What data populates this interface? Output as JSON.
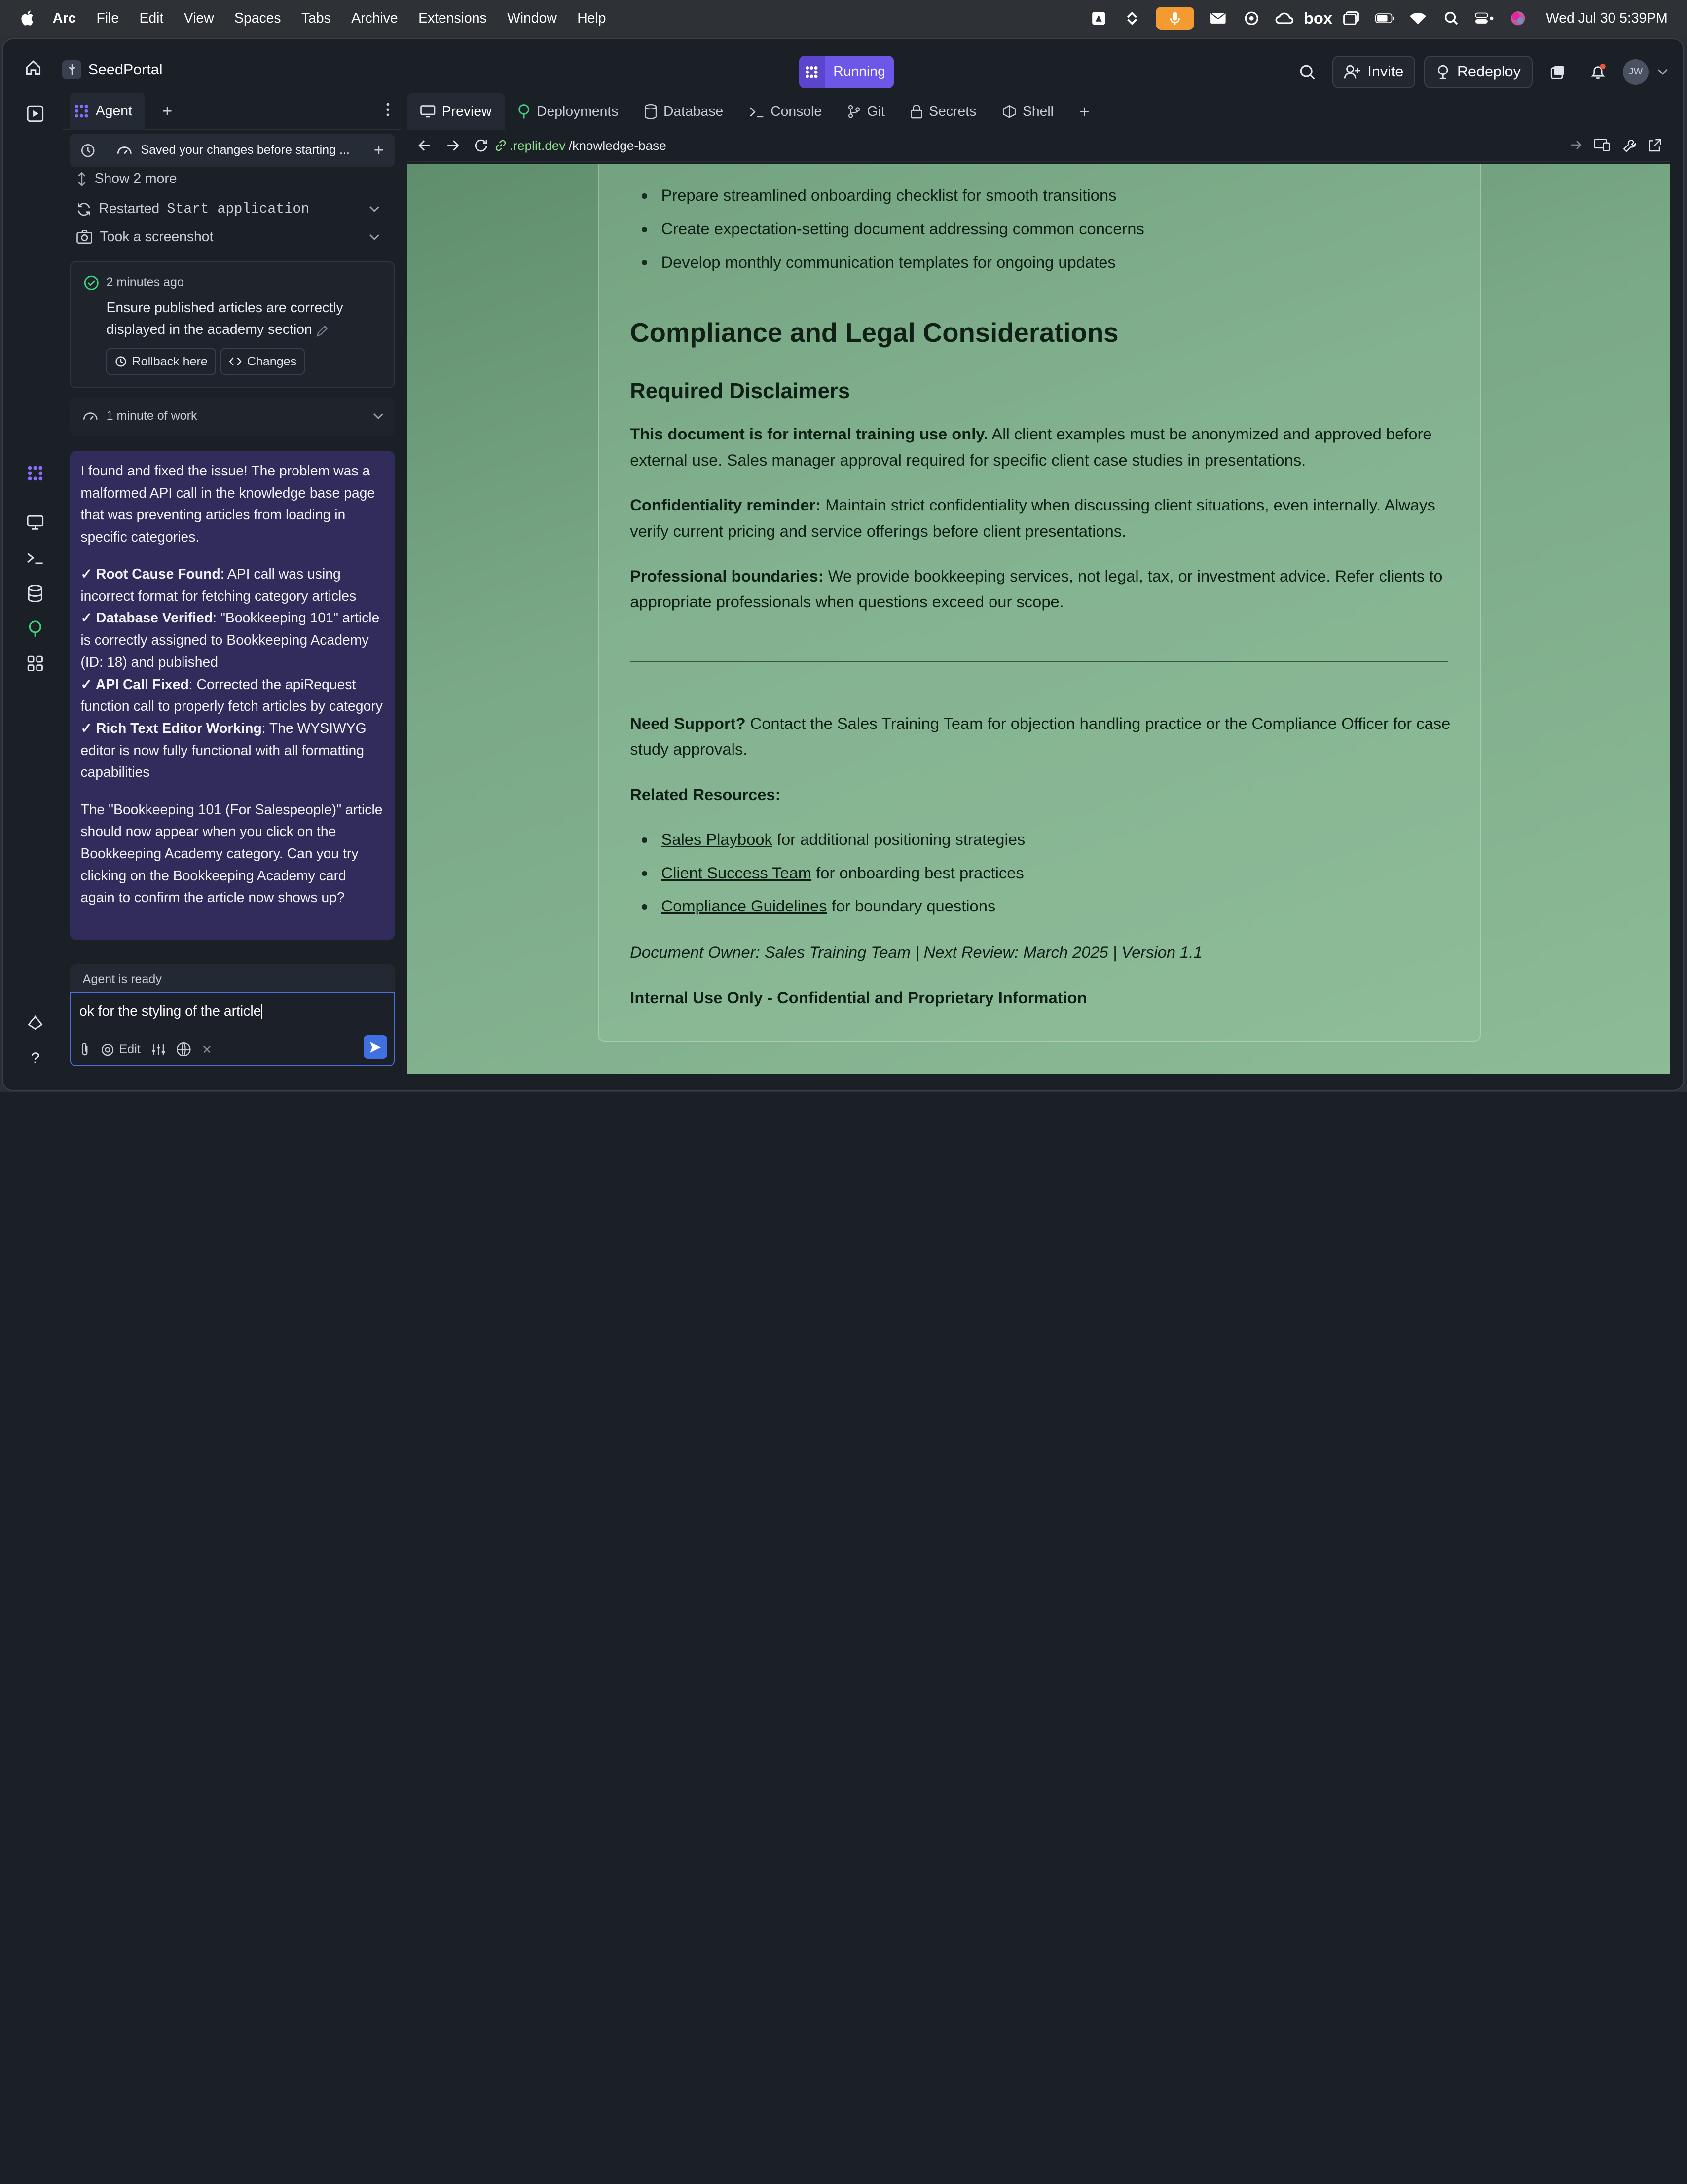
{
  "menubar": {
    "app": "Arc",
    "items": [
      "File",
      "Edit",
      "View",
      "Spaces",
      "Tabs",
      "Archive",
      "Extensions",
      "Window",
      "Help"
    ],
    "clock": "Wed Jul 30  5:39PM",
    "box_label": "box"
  },
  "topbar": {
    "project": "SeedPortal",
    "status": "Running",
    "invite": "Invite",
    "redeploy": "Redeploy",
    "avatar_initials": "JW"
  },
  "agent": {
    "tab_label": "Agent",
    "saved_text": "Saved your changes before starting ...",
    "show_more": "Show 2 more",
    "restarted_prefix": "Restarted",
    "restarted_code": "Start application",
    "screenshot": "Took a screenshot",
    "checkpoint": {
      "time": "2 minutes ago",
      "text": "Ensure published articles are correctly displayed in the academy section",
      "rollback": "Rollback here",
      "changes": "Changes"
    },
    "work": "1 minute of work",
    "message": {
      "intro": "I found and fixed the issue! The problem was a malformed API call in the knowledge base page that was preventing articles from loading in specific categories.",
      "items": [
        {
          "check": "✓ ",
          "title": "Root Cause Found",
          "text": ": API call was using incorrect format for fetching category articles"
        },
        {
          "check": "✓ ",
          "title": "Database Verified",
          "text": ": \"Bookkeeping 101\" article is correctly assigned to Bookkeeping Academy (ID: 18) and published"
        },
        {
          "check": "✓ ",
          "title": "API Call Fixed",
          "text": ": Corrected the apiRequest function call to properly fetch articles by category"
        },
        {
          "check": "✓ ",
          "title": "Rich Text Editor Working",
          "text": ": The WYSIWYG editor is now fully functional with all formatting capabilities"
        }
      ],
      "outro": "The \"Bookkeeping 101 (For Salespeople)\" article should now appear when you click on the Bookkeeping Academy category. Can you try clicking on the Bookkeeping Academy card again to confirm the article now shows up?"
    },
    "ready": "Agent is ready",
    "input_value": "ok for the styling of the article",
    "edit_label": "Edit"
  },
  "workspace": {
    "tabs": [
      "Preview",
      "Deployments",
      "Database",
      "Console",
      "Git",
      "Secrets",
      "Shell"
    ],
    "url_host": ".replit.dev",
    "url_path": "/knowledge-base"
  },
  "document": {
    "bullets_top": [
      "Prepare streamlined onboarding checklist for smooth transitions",
      "Create expectation-setting document addressing common concerns",
      "Develop monthly communication templates for ongoing updates"
    ],
    "h2": "Compliance and Legal Considerations",
    "h3": "Required Disclaimers",
    "p1_bold": "This document is for internal training use only.",
    "p1_rest": " All client examples must be anonymized and approved before external use. Sales manager approval required for specific client case studies in presentations.",
    "p2_bold": "Confidentiality reminder:",
    "p2_rest": " Maintain strict confidentiality when discussing client situations, even internally. Always verify current pricing and service offerings before client presentations.",
    "p3_bold": "Professional boundaries:",
    "p3_rest": " We provide bookkeeping services, not legal, tax, or investment advice. Refer clients to appropriate professionals when questions exceed our scope.",
    "support_bold": "Need Support?",
    "support_rest": " Contact the Sales Training Team for objection handling practice or the Compliance Officer for case study approvals.",
    "related": "Related Resources:",
    "links": [
      {
        "label": "Sales Playbook",
        "rest": " for additional positioning strategies"
      },
      {
        "label": "Client Success Team",
        "rest": " for onboarding best practices"
      },
      {
        "label": "Compliance Guidelines",
        "rest": " for boundary questions"
      }
    ],
    "owner": "Document Owner: Sales Training Team | Next Review: March 2025 | Version 1.1",
    "footer": "Internal Use Only - Confidential and Proprietary Information"
  }
}
